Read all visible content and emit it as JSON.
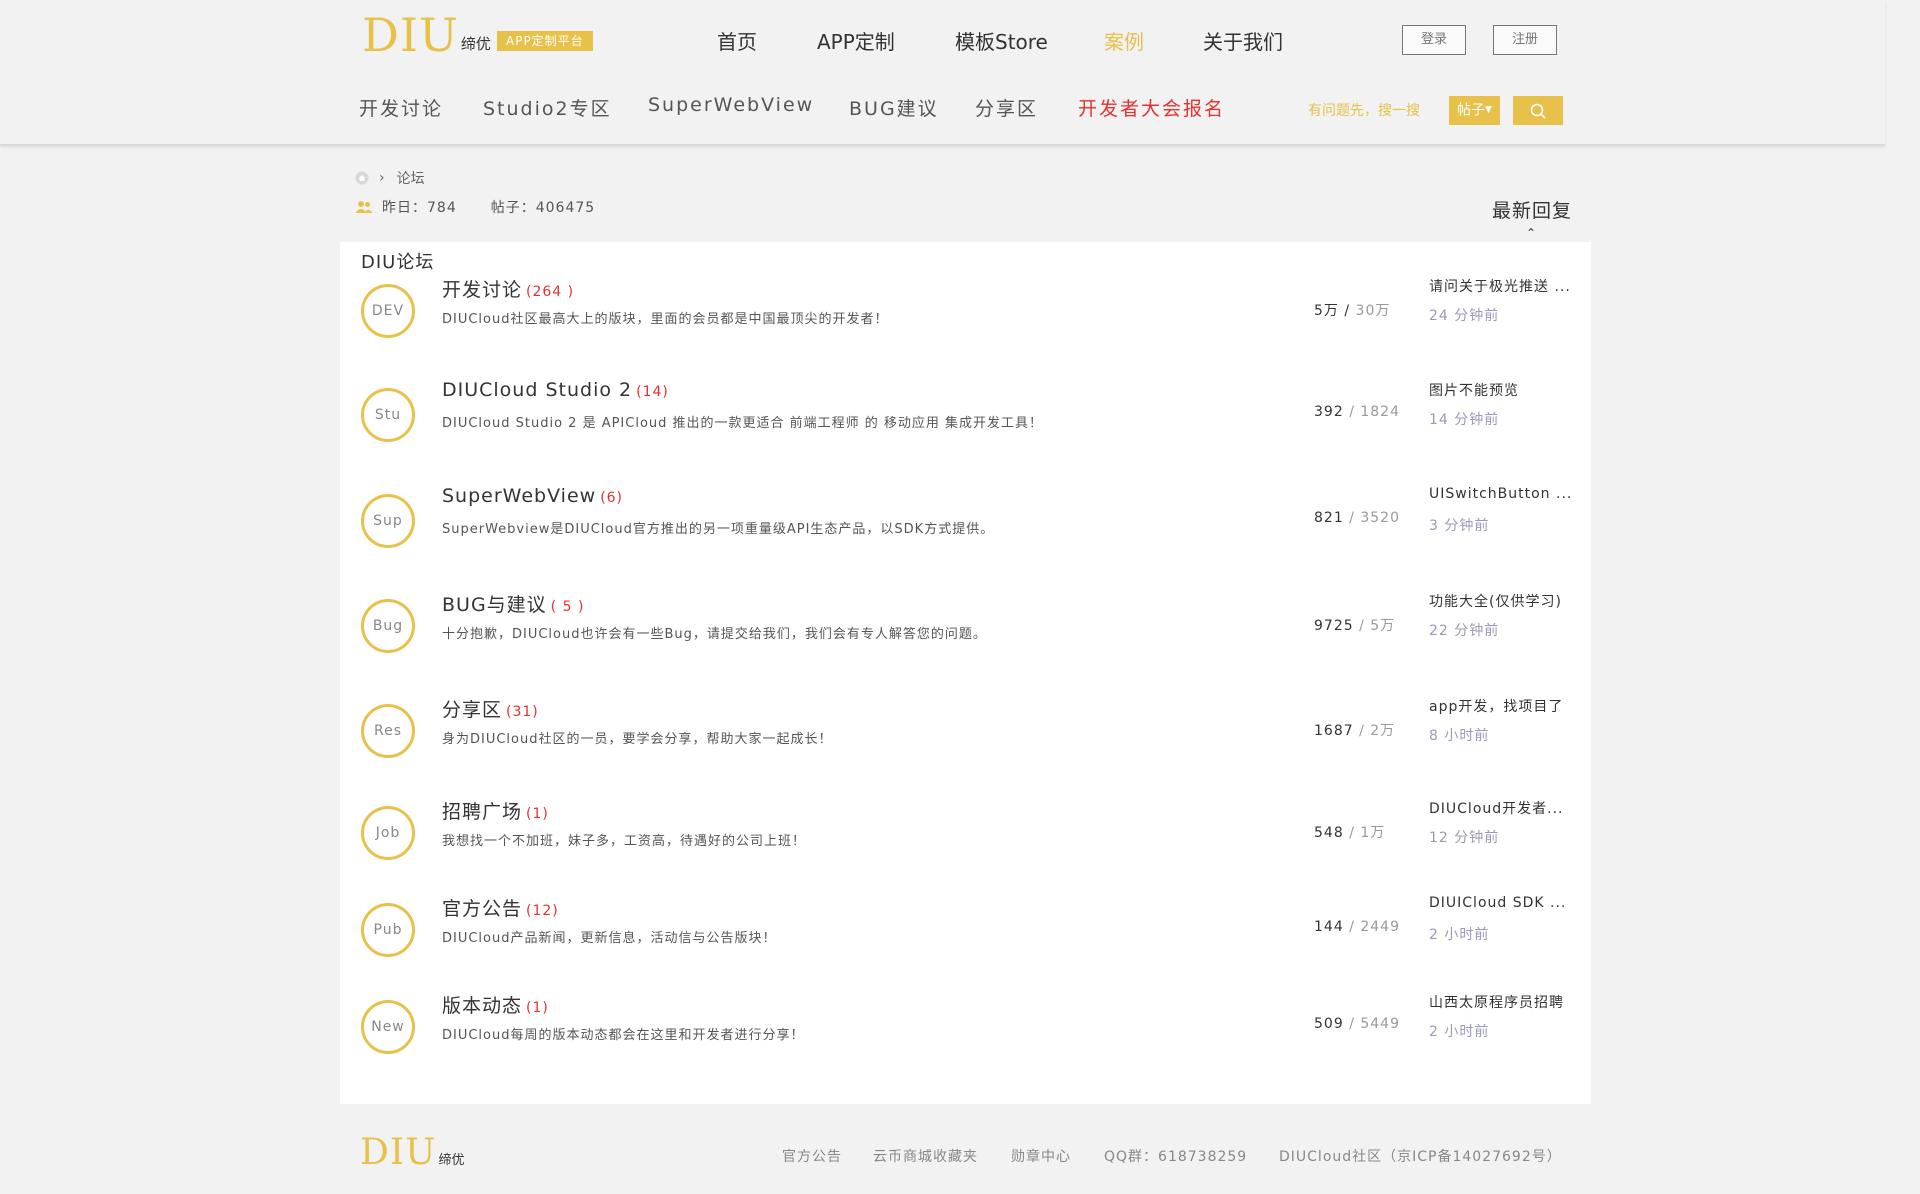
{
  "brand": {
    "logo": "DIU",
    "logo_cn": "缔优",
    "badge": "APP定制平台",
    "accent_color": "#e8c14a",
    "hot_color": "#e83030"
  },
  "main_nav": [
    "首页",
    "APP定制",
    "模板Store",
    "案例",
    "关于我们"
  ],
  "auth": {
    "login": "登录",
    "register": "注册"
  },
  "sub_nav": [
    "开发讨论",
    "Studio2专区",
    "SuperWebView",
    "BUG建议",
    "分享区",
    "开发者大会报名"
  ],
  "search": {
    "hint": "有问题先，搜一搜",
    "type": "帖子",
    "icon": "search-icon"
  },
  "breadcrumb": {
    "home_icon": "home-icon",
    "sep": "›",
    "current": "论坛"
  },
  "stats": {
    "yesterday": "昨日：784",
    "posts": "帖子：406475",
    "icon": "users-icon"
  },
  "latest_reply": "最新回复",
  "latest_caret": "⌃",
  "panel_title": "DIU论坛",
  "forums": [
    {
      "abbr": "DEV",
      "name": "开发讨论",
      "count": "(264 )",
      "desc": "DIUCloud社区最高大上的版块，里面的会员都是中国最顶尖的开发者！",
      "a": "5万 /",
      "b": "30万",
      "last": "请问关于极光推送 ...",
      "time": "24 分钟前"
    },
    {
      "abbr": "Stu",
      "name": "DIUCloud Studio 2",
      "count": "(14)",
      "desc": "DIUCloud Studio 2 是 APICloud 推出的一款更适合 前端工程师 的 移动应用 集成开发工具！",
      "a": "392",
      "b": "/ 1824",
      "last": "图片不能预览",
      "time": "14 分钟前"
    },
    {
      "abbr": "Sup",
      "name": "SuperWebView",
      "count": "(6)",
      "desc": "SuperWebview是DIUCloud官方推出的另一项重量级API生态产品，以SDK方式提供。",
      "a": "821",
      "b": "/ 3520",
      "last": "UISwitchButton ...",
      "time": "3 分钟前"
    },
    {
      "abbr": "Bug",
      "name": "BUG与建议",
      "count": "( 5 )",
      "desc": "十分抱歉，DIUCloud也许会有一些Bug，请提交给我们，我们会有专人解答您的问题。",
      "a": "9725",
      "b": "/ 5万",
      "last": "功能大全(仅供学习)",
      "time": "22 分钟前"
    },
    {
      "abbr": "Res",
      "name": "分享区",
      "count": "(31)",
      "desc": "身为DIUCloud社区的一员，要学会分享，帮助大家一起成长！",
      "a": "1687",
      "b": "/ 2万",
      "last": "app开发，找项目了",
      "time": "8 小时前"
    },
    {
      "abbr": "Job",
      "name": "招聘广场",
      "count": "(1)",
      "desc": "我想找一个不加班，妹子多，工资高，待遇好的公司上班！",
      "a": "548",
      "b": "/ 1万",
      "last": "DIUCloud开发者...",
      "time": "12 分钟前"
    },
    {
      "abbr": "Pub",
      "name": "官方公告",
      "count": "(12)",
      "desc": "DIUCloud产品新闻，更新信息，活动信与公告版块！",
      "a": "144",
      "b": "/ 2449",
      "last": "DIUICloud SDK ...",
      "time": "2 小时前"
    },
    {
      "abbr": "New",
      "name": "版本动态",
      "count": "(1)",
      "desc": "DIUCloud每周的版本动态都会在这里和开发者进行分享！",
      "a": "509",
      "b": "/ 5449",
      "last": "山西太原程序员招聘",
      "time": "2 小时前"
    }
  ],
  "footer": {
    "logo": "DIU",
    "logo_cn": "缔优",
    "links": [
      "官方公告",
      "云币商城收藏夹",
      "勋章中心",
      "QQ群：618738259",
      "DIUCloud社区（京ICP备14027692号）"
    ]
  }
}
